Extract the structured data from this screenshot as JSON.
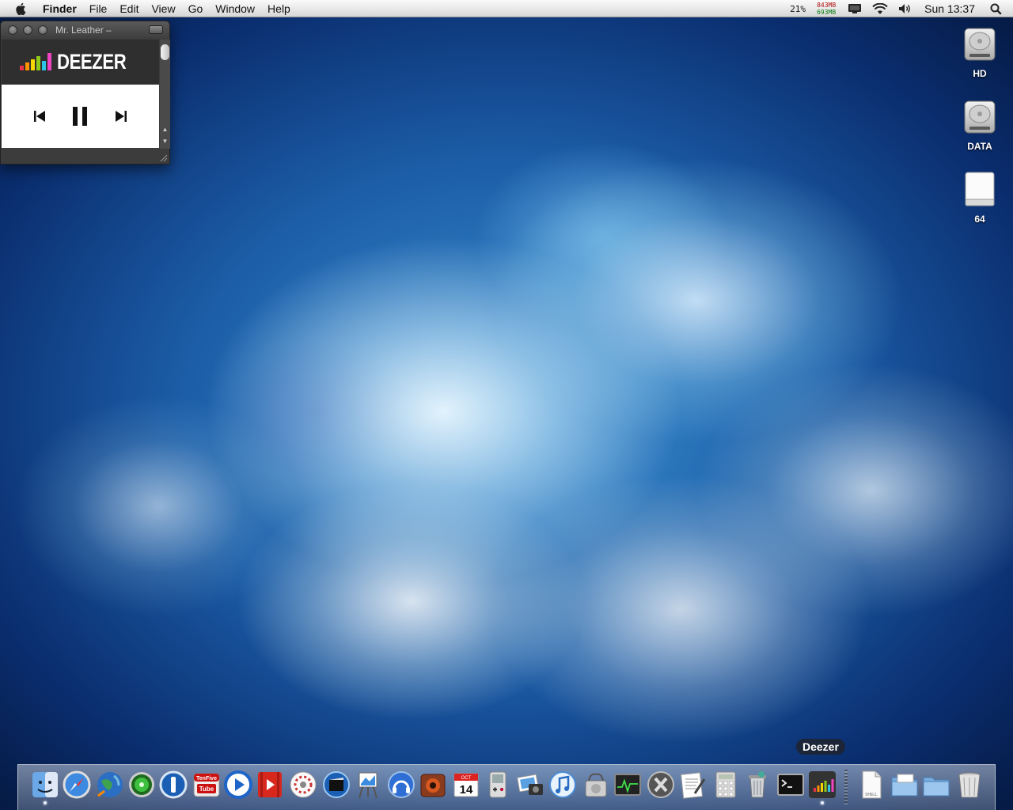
{
  "menubar": {
    "app_name": "Finder",
    "menus": [
      "File",
      "Edit",
      "View",
      "Go",
      "Window",
      "Help"
    ],
    "battery_percent": "21%",
    "memory_used": "843MB",
    "memory_free": "693MB",
    "clock": "Sun 13:37"
  },
  "deezer_window": {
    "title": "Mr. Leather –",
    "logo_text": "DEEZER"
  },
  "desktop_icons": [
    {
      "label": "HD",
      "icon": "hard-drive-icon"
    },
    {
      "label": "DATA",
      "icon": "hard-drive-icon"
    },
    {
      "label": "64",
      "icon": "external-drive-icon"
    }
  ],
  "dock": {
    "tooltip": "Deezer",
    "apps": [
      "finder",
      "safari",
      "world-globe",
      "app-radar",
      "1password",
      "tenfive-youtube",
      "quicktime",
      "video-player",
      "cd-app",
      "imovie",
      "preview-art",
      "audio-app",
      "radio-app",
      "ical",
      "gameboy",
      "photos",
      "itunes",
      "disk-utility",
      "activity-monitor",
      "osx-app",
      "textedit",
      "calculator",
      "trash-app",
      "terminal",
      "deezer"
    ],
    "ical_date": "14",
    "ical_month": "OCT",
    "tenfive_top": "TenFive",
    "tenfive_bottom": "Tube",
    "shell_label": "SHELL"
  },
  "colors": {
    "deezer_bars": [
      "#e8334a",
      "#ff9300",
      "#f6d500",
      "#8fc919",
      "#2ec4e8",
      "#f044c2"
    ]
  }
}
